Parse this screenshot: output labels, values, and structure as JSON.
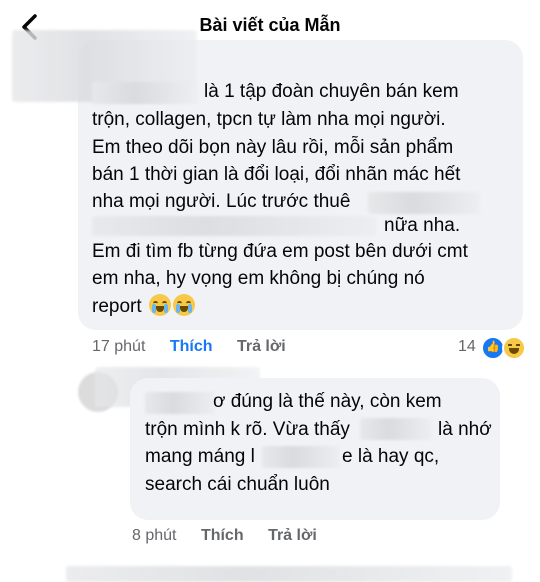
{
  "header": {
    "title": "Bài viết của Mẫn"
  },
  "comment1": {
    "lines": [
      "là 1 tập đoàn chuyên bán kem",
      "trộn, collagen, tpcn tự làm nha mọi người.",
      "Em theo dõi bọn này lâu rồi, mỗi sản phẩm",
      "bán 1 thời gian là đổi loại, đổi nhãn mác hết",
      "nha mọi người. Lúc trước thuê",
      "nữa nha.",
      "Em đi tìm fb từng đứa em post bên dưới cmt",
      "em nha, hy vọng em không bị chúng nó",
      "report"
    ],
    "time": "17 phút",
    "like_label": "Thích",
    "reply_label": "Trả lời",
    "reaction_count": "14"
  },
  "comment2": {
    "lines": [
      "ơ đúng là thế này, còn kem",
      "trộn mình k rõ. Vừa thấy",
      "là nhớ",
      "mang máng l",
      "e là hay qc,",
      "search cái chuẩn luôn"
    ],
    "time": "8 phút",
    "like_label": "Thích",
    "reply_label": "Trả lời"
  }
}
